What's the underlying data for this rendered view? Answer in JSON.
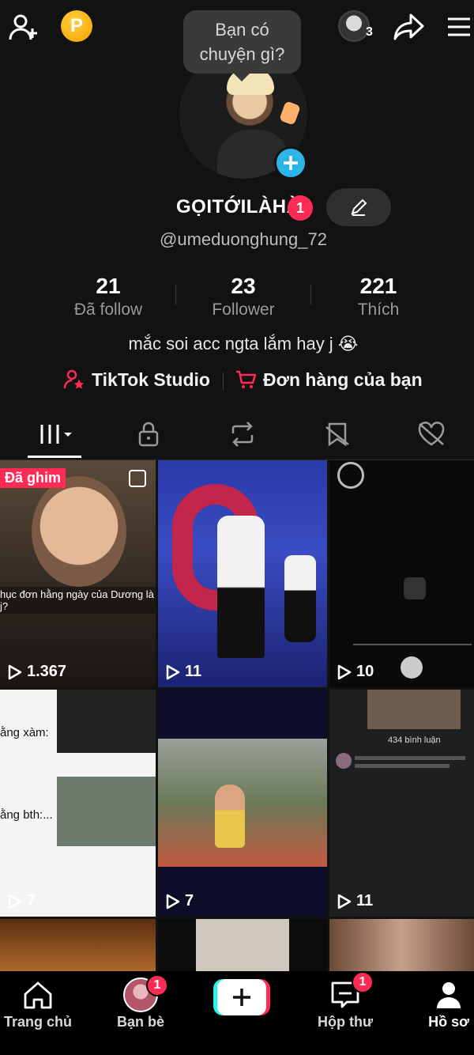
{
  "header": {
    "bubble_line1": "Bạn có",
    "bubble_line2": "chuyện gì?",
    "avatar_count": "3",
    "icons": [
      "add-user-icon",
      "coin-icon",
      "share-icon",
      "menu-icon"
    ]
  },
  "profile": {
    "display_name": "GỌITỚILÀHÀ",
    "name_badge": "1",
    "username": "@umeduonghung_72",
    "bio": "mắc soi acc ngta lắm hay j 😭"
  },
  "stats": [
    {
      "value": "21",
      "label": "Đã follow"
    },
    {
      "value": "23",
      "label": "Follower"
    },
    {
      "value": "221",
      "label": "Thích"
    }
  ],
  "links": {
    "studio": "TikTok Studio",
    "orders": "Đơn hàng của bạn"
  },
  "tabs": [
    "videos-tab",
    "private-tab",
    "repost-tab",
    "saved-tab",
    "liked-tab"
  ],
  "grid": {
    "pin_label": "Đã ghim",
    "items": [
      {
        "views": "1.367",
        "caption": "hục đơn hằng ngày của Dương là j?"
      },
      {
        "views": "11"
      },
      {
        "views": "10"
      },
      {
        "views": "7",
        "caption": "ằng xàm:",
        "caption2": "ằng bth:..."
      },
      {
        "views": "7"
      },
      {
        "views": "11",
        "caption": "434 bình luận"
      }
    ]
  },
  "bottom_nav": {
    "home": "Trang chủ",
    "friends": "Bạn bè",
    "friends_badge": "1",
    "inbox": "Hộp thư",
    "inbox_badge": "1",
    "profile": "Hồ sơ"
  },
  "colors": {
    "accent": "#fe2c55",
    "cyan": "#25f4ee",
    "background": "#121212"
  }
}
